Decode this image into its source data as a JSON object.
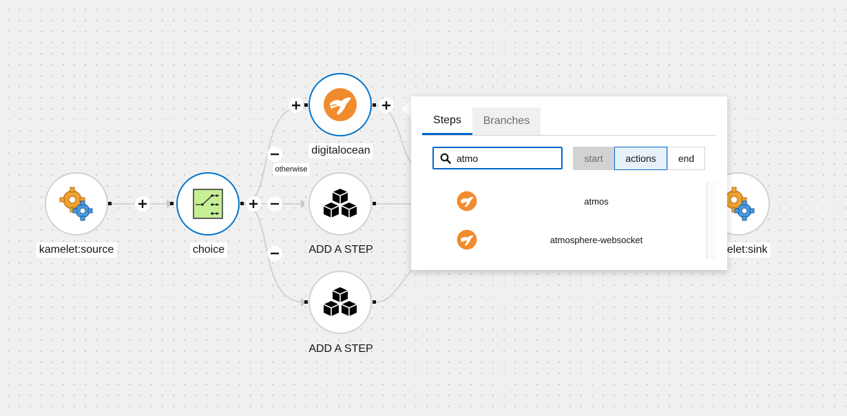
{
  "nodes": {
    "source": {
      "label": "kamelet:source",
      "icon": "kamelet-gears-icon"
    },
    "choice": {
      "label": "choice",
      "icon": "choice-switch-icon"
    },
    "digitalocean": {
      "label": "digitalocean",
      "icon": "camel-icon"
    },
    "step1": {
      "label": "ADD A STEP",
      "icon": "cubes-icon"
    },
    "step2": {
      "label": "ADD A STEP",
      "icon": "cubes-icon"
    },
    "sink": {
      "label": "kamelet:sink",
      "icon": "kamelet-gears-icon"
    }
  },
  "branch_label": "otherwise",
  "popover": {
    "tabs": [
      {
        "label": "Steps",
        "active": true
      },
      {
        "label": "Branches",
        "active": false
      }
    ],
    "search": {
      "value": "atmo"
    },
    "filters": [
      {
        "label": "start",
        "state": "disabled"
      },
      {
        "label": "actions",
        "state": "selected"
      },
      {
        "label": "end",
        "state": "default"
      }
    ],
    "results": [
      {
        "name": "atmos",
        "icon": "camel-icon"
      },
      {
        "name": "atmosphere-websocket",
        "icon": "camel-icon"
      }
    ]
  },
  "colors": {
    "selected_border": "#0073c8",
    "camel_orange": "#f08c2e",
    "choice_green": "#c6ef96",
    "link_blue": "#0066cc"
  }
}
